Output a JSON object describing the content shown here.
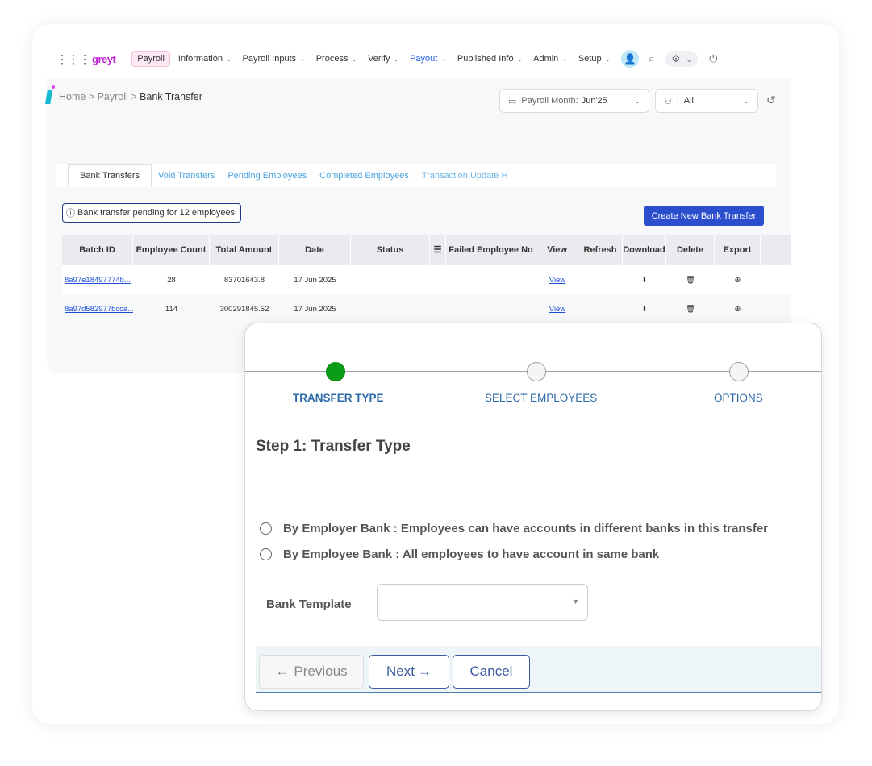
{
  "topnav": {
    "logo": "greyt",
    "items": [
      {
        "label": "Payroll",
        "caret": false
      },
      {
        "label": "Information",
        "caret": true
      },
      {
        "label": "Payroll Inputs",
        "caret": true
      },
      {
        "label": "Process",
        "caret": true
      },
      {
        "label": "Verify",
        "caret": true
      },
      {
        "label": "Payout",
        "caret": true
      },
      {
        "label": "Published Info",
        "caret": true
      },
      {
        "label": "Admin",
        "caret": true
      },
      {
        "label": "Setup",
        "caret": true
      }
    ]
  },
  "breadcrumb": {
    "home": "Home",
    "sep1": " > ",
    "payroll": "Payroll",
    "sep2": " > ",
    "current": "Bank Transfer"
  },
  "filters": {
    "month_label": "Payroll Month:",
    "month_value": "Jun'25",
    "group_value": "All"
  },
  "tabs": [
    "Bank Transfers",
    "Void Transfers",
    "Pending Employees",
    "Completed Employees",
    "Transaction Update H"
  ],
  "pending_badge": "Bank transfer pending for 12 employees.",
  "create_button": "Create New Bank Transfer",
  "table": {
    "headers": [
      "Batch ID",
      "Employee Count",
      "Total Amount",
      "Date",
      "Status",
      "",
      "Failed Employee No",
      "View",
      "Refresh",
      "Download",
      "Delete",
      "Export"
    ],
    "rows": [
      {
        "batch_id": "8a97e18497774b...",
        "count": "28",
        "amount": "83701643.8",
        "date": "17 Jun 2025",
        "view": "View"
      },
      {
        "batch_id": "8a97d582977bcca...",
        "count": "114",
        "amount": "300291845.52",
        "date": "17 Jun 2025",
        "view": "View"
      }
    ]
  },
  "wizard": {
    "steps": [
      "TRANSFER TYPE",
      "SELECT EMPLOYEES",
      "OPTIONS"
    ],
    "title": "Step 1: Transfer Type",
    "option1": "By Employer Bank : Employees can have accounts in different banks in this transfer",
    "option2": "By Employee Bank : All employees to have account in same bank",
    "template_label": "Bank Template",
    "template_value": "",
    "previous": "Previous",
    "next": "Next",
    "cancel": "Cancel"
  },
  "colors": {
    "accent_blue": "#2b4ecf",
    "step_done": "#0c9d17",
    "link": "#1d4ed8",
    "logo": "#c026d3"
  }
}
